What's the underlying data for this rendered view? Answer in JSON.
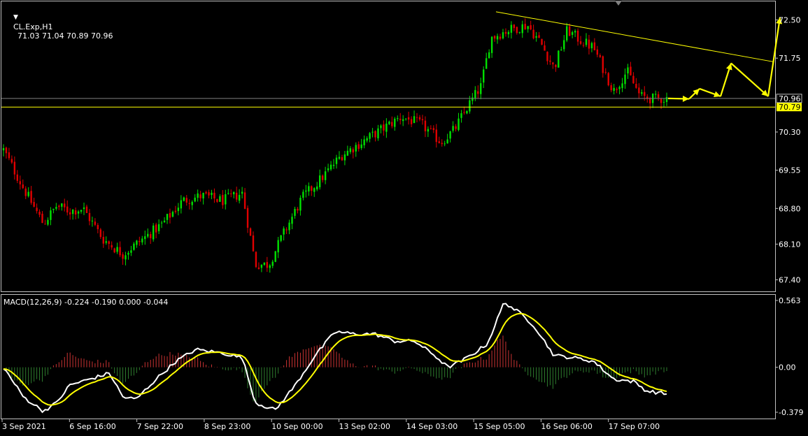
{
  "main_header": {
    "symbol_text": "CL.Exp,H1",
    "ohlc_text": "71.03 71.04 70.89 70.96"
  },
  "macd_header": {
    "text": "MACD(12,26,9) -0.224 -0.190 0.000 -0.044"
  },
  "colors": {
    "background": "#000000",
    "bull_candle": "#00e000",
    "bear_candle": "#e00000",
    "macd_line": "#ffffff",
    "signal_line": "#ffff00",
    "hist_positive": "#cc3333",
    "hist_negative": "#2e7d2e",
    "annotation": "#ffff00",
    "border": "#c0c0c0",
    "bid_line": "#808080",
    "level_line": "#ffff00"
  },
  "chart_data": [
    {
      "type": "candlestick",
      "title": "CL.Exp,H1",
      "y_ticks": [
        "72.50",
        "71.75",
        "70.30",
        "69.55",
        "68.80",
        "68.10",
        "67.40"
      ],
      "ylim": [
        67.2,
        72.85
      ],
      "x_ticks": [
        "3 Sep 2021",
        "6 Sep 16:00",
        "7 Sep 22:00",
        "8 Sep 23:00",
        "10 Sep 00:00",
        "13 Sep 02:00",
        "14 Sep 03:00",
        "15 Sep 05:00",
        "16 Sep 06:00",
        "17 Sep 07:00"
      ],
      "grid": false,
      "price_labels": [
        {
          "value": 70.96,
          "label": "70.96",
          "style": "bid"
        },
        {
          "value": 70.79,
          "label": "70.79",
          "style": "level"
        }
      ],
      "trendline": {
        "from": [
          "15 Sep 05:00",
          72.66
        ],
        "to": [
          "projection",
          71.68
        ]
      },
      "path_anchors": [
        {
          "x": 0.0,
          "close": 69.95
        },
        {
          "x": 0.03,
          "close": 69.2
        },
        {
          "x": 0.06,
          "close": 68.5
        },
        {
          "x": 0.08,
          "close": 68.85
        },
        {
          "x": 0.1,
          "close": 68.75
        },
        {
          "x": 0.12,
          "close": 68.8
        },
        {
          "x": 0.15,
          "close": 68.2
        },
        {
          "x": 0.18,
          "close": 67.9
        },
        {
          "x": 0.21,
          "close": 68.2
        },
        {
          "x": 0.24,
          "close": 68.5
        },
        {
          "x": 0.27,
          "close": 68.95
        },
        {
          "x": 0.3,
          "close": 69.05
        },
        {
          "x": 0.33,
          "close": 68.95
        },
        {
          "x": 0.36,
          "close": 69.1
        },
        {
          "x": 0.38,
          "close": 67.7
        },
        {
          "x": 0.4,
          "close": 67.7
        },
        {
          "x": 0.42,
          "close": 68.25
        },
        {
          "x": 0.45,
          "close": 69.0
        },
        {
          "x": 0.48,
          "close": 69.4
        },
        {
          "x": 0.51,
          "close": 69.85
        },
        {
          "x": 0.54,
          "close": 70.1
        },
        {
          "x": 0.57,
          "close": 70.35
        },
        {
          "x": 0.6,
          "close": 70.6
        },
        {
          "x": 0.63,
          "close": 70.45
        },
        {
          "x": 0.66,
          "close": 70.1
        },
        {
          "x": 0.68,
          "close": 70.35
        },
        {
          "x": 0.7,
          "close": 70.8
        },
        {
          "x": 0.72,
          "close": 71.2
        },
        {
          "x": 0.735,
          "close": 72.15
        },
        {
          "x": 0.76,
          "close": 72.3
        },
        {
          "x": 0.79,
          "close": 72.4
        },
        {
          "x": 0.81,
          "close": 72.05
        },
        {
          "x": 0.83,
          "close": 71.55
        },
        {
          "x": 0.85,
          "close": 72.3
        },
        {
          "x": 0.87,
          "close": 72.1
        },
        {
          "x": 0.89,
          "close": 71.95
        },
        {
          "x": 0.92,
          "close": 71.1
        },
        {
          "x": 0.94,
          "close": 71.5
        },
        {
          "x": 0.96,
          "close": 71.0
        },
        {
          "x": 0.98,
          "close": 70.95
        },
        {
          "x": 1.0,
          "close": 70.96
        }
      ]
    },
    {
      "type": "macd",
      "title": "MACD(12,26,9)",
      "parameters": [
        12,
        26,
        9
      ],
      "values": {
        "macd": -0.224,
        "signal": -0.19,
        "level": 0.0,
        "histogram": -0.044
      },
      "y_ticks": [
        "0.563",
        "0.00",
        "-0.379"
      ],
      "ylim": [
        -0.379,
        0.563
      ],
      "macd_anchors": [
        {
          "x": 0.0,
          "y": 0.0
        },
        {
          "x": 0.03,
          "y": -0.25
        },
        {
          "x": 0.06,
          "y": -0.37
        },
        {
          "x": 0.08,
          "y": -0.3
        },
        {
          "x": 0.1,
          "y": -0.15
        },
        {
          "x": 0.13,
          "y": -0.1
        },
        {
          "x": 0.16,
          "y": -0.05
        },
        {
          "x": 0.18,
          "y": -0.25
        },
        {
          "x": 0.2,
          "y": -0.27
        },
        {
          "x": 0.23,
          "y": -0.1
        },
        {
          "x": 0.26,
          "y": 0.05
        },
        {
          "x": 0.29,
          "y": 0.15
        },
        {
          "x": 0.33,
          "y": 0.12
        },
        {
          "x": 0.36,
          "y": 0.08
        },
        {
          "x": 0.38,
          "y": -0.3
        },
        {
          "x": 0.41,
          "y": -0.36
        },
        {
          "x": 0.44,
          "y": -0.15
        },
        {
          "x": 0.47,
          "y": 0.1
        },
        {
          "x": 0.5,
          "y": 0.3
        },
        {
          "x": 0.53,
          "y": 0.28
        },
        {
          "x": 0.56,
          "y": 0.28
        },
        {
          "x": 0.59,
          "y": 0.22
        },
        {
          "x": 0.62,
          "y": 0.22
        },
        {
          "x": 0.65,
          "y": 0.1
        },
        {
          "x": 0.67,
          "y": 0.0
        },
        {
          "x": 0.69,
          "y": 0.05
        },
        {
          "x": 0.71,
          "y": 0.12
        },
        {
          "x": 0.73,
          "y": 0.2
        },
        {
          "x": 0.755,
          "y": 0.55
        },
        {
          "x": 0.78,
          "y": 0.45
        },
        {
          "x": 0.8,
          "y": 0.35
        },
        {
          "x": 0.83,
          "y": 0.1
        },
        {
          "x": 0.86,
          "y": 0.08
        },
        {
          "x": 0.89,
          "y": 0.05
        },
        {
          "x": 0.92,
          "y": -0.1
        },
        {
          "x": 0.95,
          "y": -0.12
        },
        {
          "x": 0.97,
          "y": -0.2
        },
        {
          "x": 1.0,
          "y": -0.224
        }
      ]
    }
  ],
  "annotation": {
    "type": "zigzag-projection-arrows",
    "color": "#ffff00"
  }
}
